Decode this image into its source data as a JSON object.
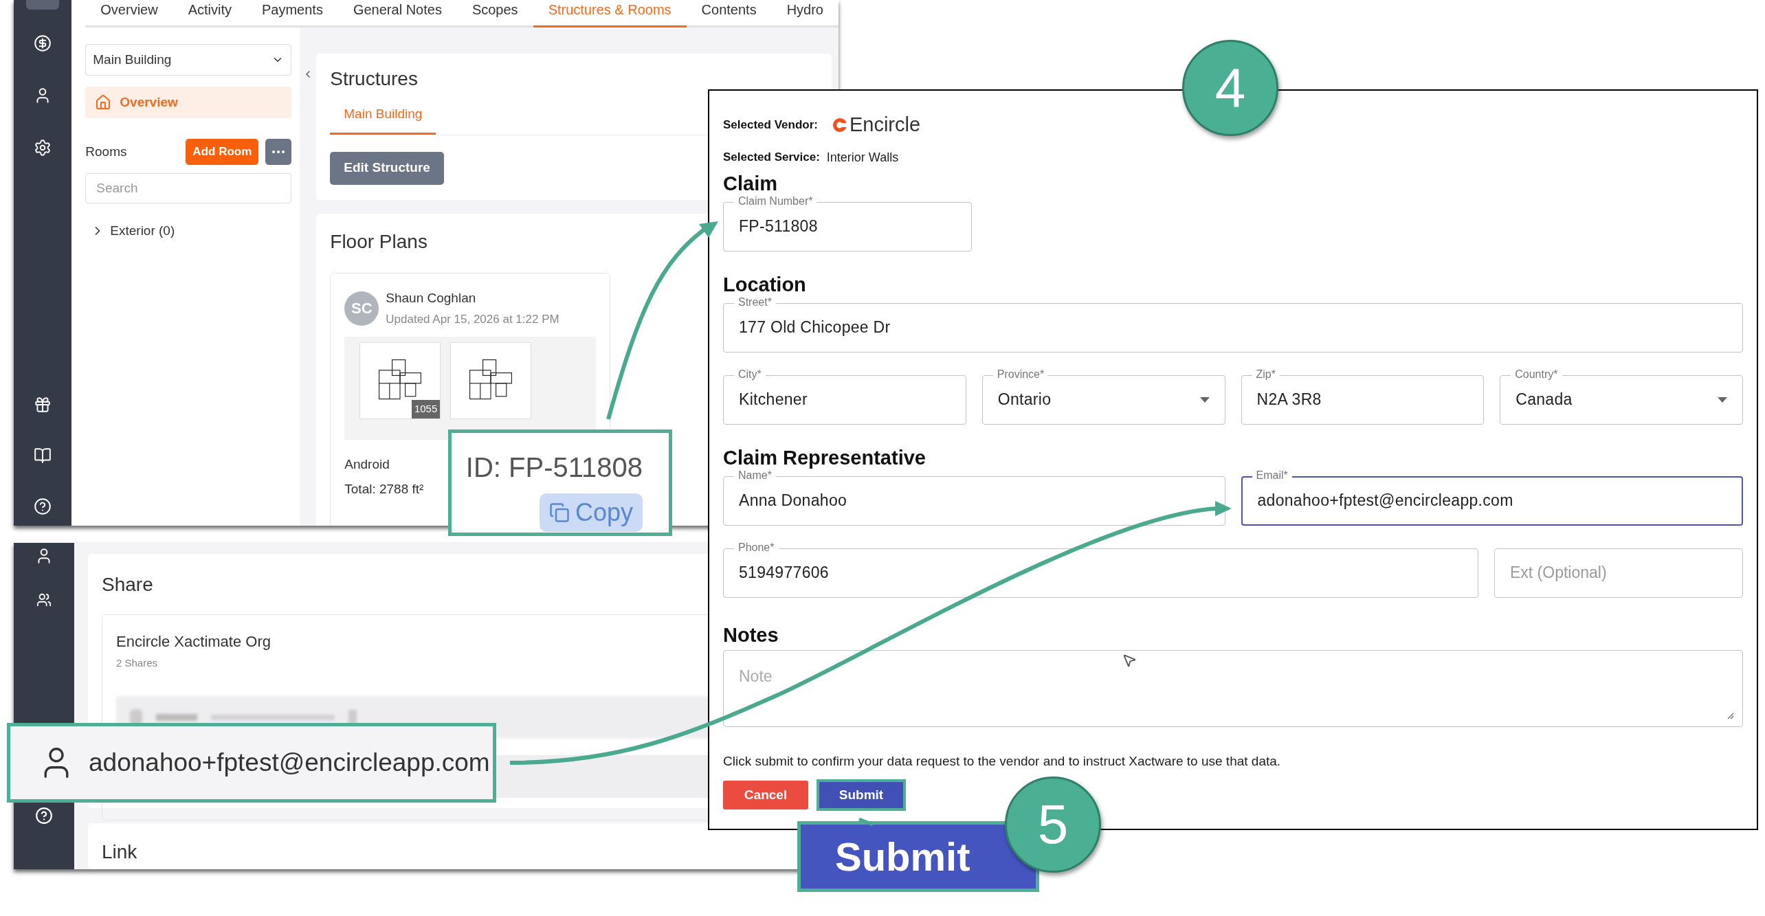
{
  "top_app": {
    "tabs": [
      {
        "label": "Overview",
        "selected": false
      },
      {
        "label": "Activity",
        "selected": false
      },
      {
        "label": "Payments",
        "selected": false
      },
      {
        "label": "General Notes",
        "selected": false
      },
      {
        "label": "Scopes",
        "selected": false
      },
      {
        "label": "Structures & Rooms",
        "selected": true
      },
      {
        "label": "Contents",
        "selected": false
      },
      {
        "label": "Hydro",
        "selected": false
      }
    ],
    "structure_select": "Main Building",
    "nav_item": {
      "label": "Overview",
      "selected": true
    },
    "rooms_label": "Rooms",
    "add_room_button": "Add Room",
    "room_search": {
      "placeholder": "Search"
    },
    "room_tree": [
      {
        "label": "Exterior (0)",
        "expanded": false
      }
    ],
    "structures": {
      "title": "Structures",
      "tabs": [
        {
          "label": "Main Building",
          "selected": true
        }
      ],
      "edit_button": "Edit Structure"
    },
    "floor_plans": {
      "title": "Floor Plans",
      "card": {
        "initials": "SC",
        "author": "Shaun Coghlan",
        "updated": "Updated Apr 15, 2026 at 1:22 PM",
        "area_badge": "1055",
        "name": "Android",
        "total": "Total: 2788 ft²"
      }
    }
  },
  "bottom_app": {
    "share_title": "Share",
    "org_name": "Encircle Xactimate Org",
    "org_shares": "2 Shares",
    "link_title": "Link"
  },
  "form": {
    "vendor_label": "Selected Vendor:",
    "vendor": "Encircle",
    "service_label": "Selected Service:",
    "service": "Interior Walls",
    "sections": [
      {
        "title": "Claim",
        "rows": [
          {
            "fields": [
              {
                "label": "Claim Number*",
                "value": "FP-511808",
                "kind": "text",
                "focused": false
              }
            ]
          }
        ]
      },
      {
        "title": "Location",
        "rows": [
          {
            "fields": [
              {
                "label": "Street*",
                "value": "177 Old Chicopee Dr",
                "kind": "text",
                "focused": false
              }
            ]
          },
          {
            "fields": [
              {
                "label": "City*",
                "value": "Kitchener",
                "kind": "text",
                "focused": false
              },
              {
                "label": "Province*",
                "value": "Ontario",
                "kind": "select",
                "focused": false
              },
              {
                "label": "Zip*",
                "value": "N2A 3R8",
                "kind": "text",
                "focused": false
              },
              {
                "label": "Country*",
                "value": "Canada",
                "kind": "select",
                "focused": false
              }
            ]
          }
        ]
      },
      {
        "title": "Claim Representative",
        "rows": [
          {
            "fields": [
              {
                "label": "Name*",
                "value": "Anna Donahoo",
                "kind": "text",
                "focused": false
              },
              {
                "label": "Email*",
                "value": "adonahoo+fptest@encircleapp.com",
                "kind": "text",
                "focused": true
              }
            ]
          },
          {
            "fields": [
              {
                "label": "Phone*",
                "value": "5194977606",
                "kind": "text",
                "focused": false
              },
              {
                "placeholder": "Ext (Optional)",
                "kind": "text",
                "focused": false
              }
            ]
          }
        ]
      }
    ],
    "notes_title": "Notes",
    "notes": {
      "placeholder": "Note"
    },
    "confirm_text": "Click submit to confirm your data request to the vendor and to instruct Xactware to use that data.",
    "cancel_button": "Cancel",
    "submit_button": "Submit"
  },
  "callouts": {
    "id_text": "ID: FP-511808",
    "copy_button": "Copy",
    "email": "adonahoo+fptest@encircleapp.com",
    "submit_zoom": "Submit"
  },
  "step_badges": [
    "4",
    "5"
  ]
}
